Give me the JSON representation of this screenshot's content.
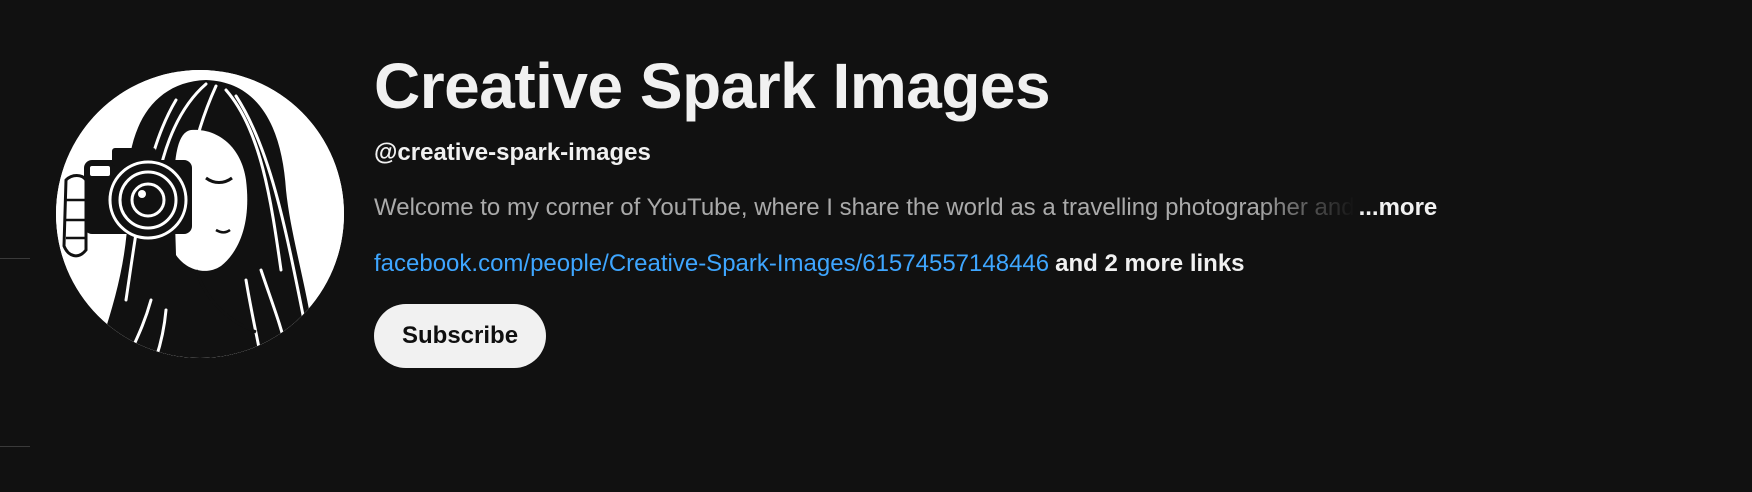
{
  "channel": {
    "name": "Creative Spark Images",
    "handle": "@creative-spark-images",
    "description": "Welcome to my corner of YouTube, where I share the world as a travelling photographer and",
    "more_label": "...more",
    "primary_link": "facebook.com/people/Creative-Spark-Images/61574557148446",
    "more_links_label": "and 2 more links",
    "subscribe_label": "Subscribe",
    "avatar_icon": "camera-girl-avatar-icon"
  },
  "colors": {
    "background": "#111111",
    "link": "#3ea6ff",
    "subscribe_bg": "#f1f1f1"
  }
}
